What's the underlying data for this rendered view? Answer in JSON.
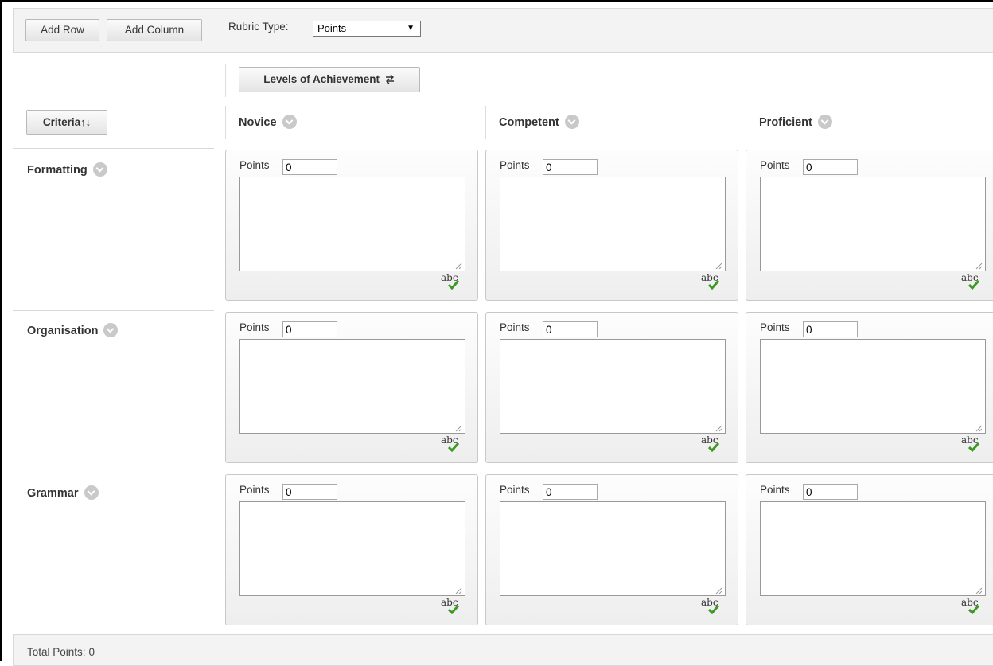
{
  "toolbar": {
    "add_row_label": "Add Row",
    "add_column_label": "Add Column",
    "rubric_type_label": "Rubric Type:",
    "rubric_type_value": "Points"
  },
  "levels_button_label": "Levels of Achievement",
  "criteria_button_label": "Criteria",
  "columns": [
    "Novice",
    "Competent",
    "Proficient"
  ],
  "criteria": [
    "Formatting",
    "Organisation",
    "Grammar"
  ],
  "cell": {
    "points_label": "Points",
    "points_value": "0",
    "spellcheck_text": "abc"
  },
  "footer": {
    "total_points_label": "Total Points:",
    "total_points_value": "0"
  },
  "colors": {
    "toolbar_bg": "#f3f3f3",
    "border": "#d8d8d8",
    "check_green": "#3c9a22",
    "chevron_grey": "#c9c9c9"
  }
}
